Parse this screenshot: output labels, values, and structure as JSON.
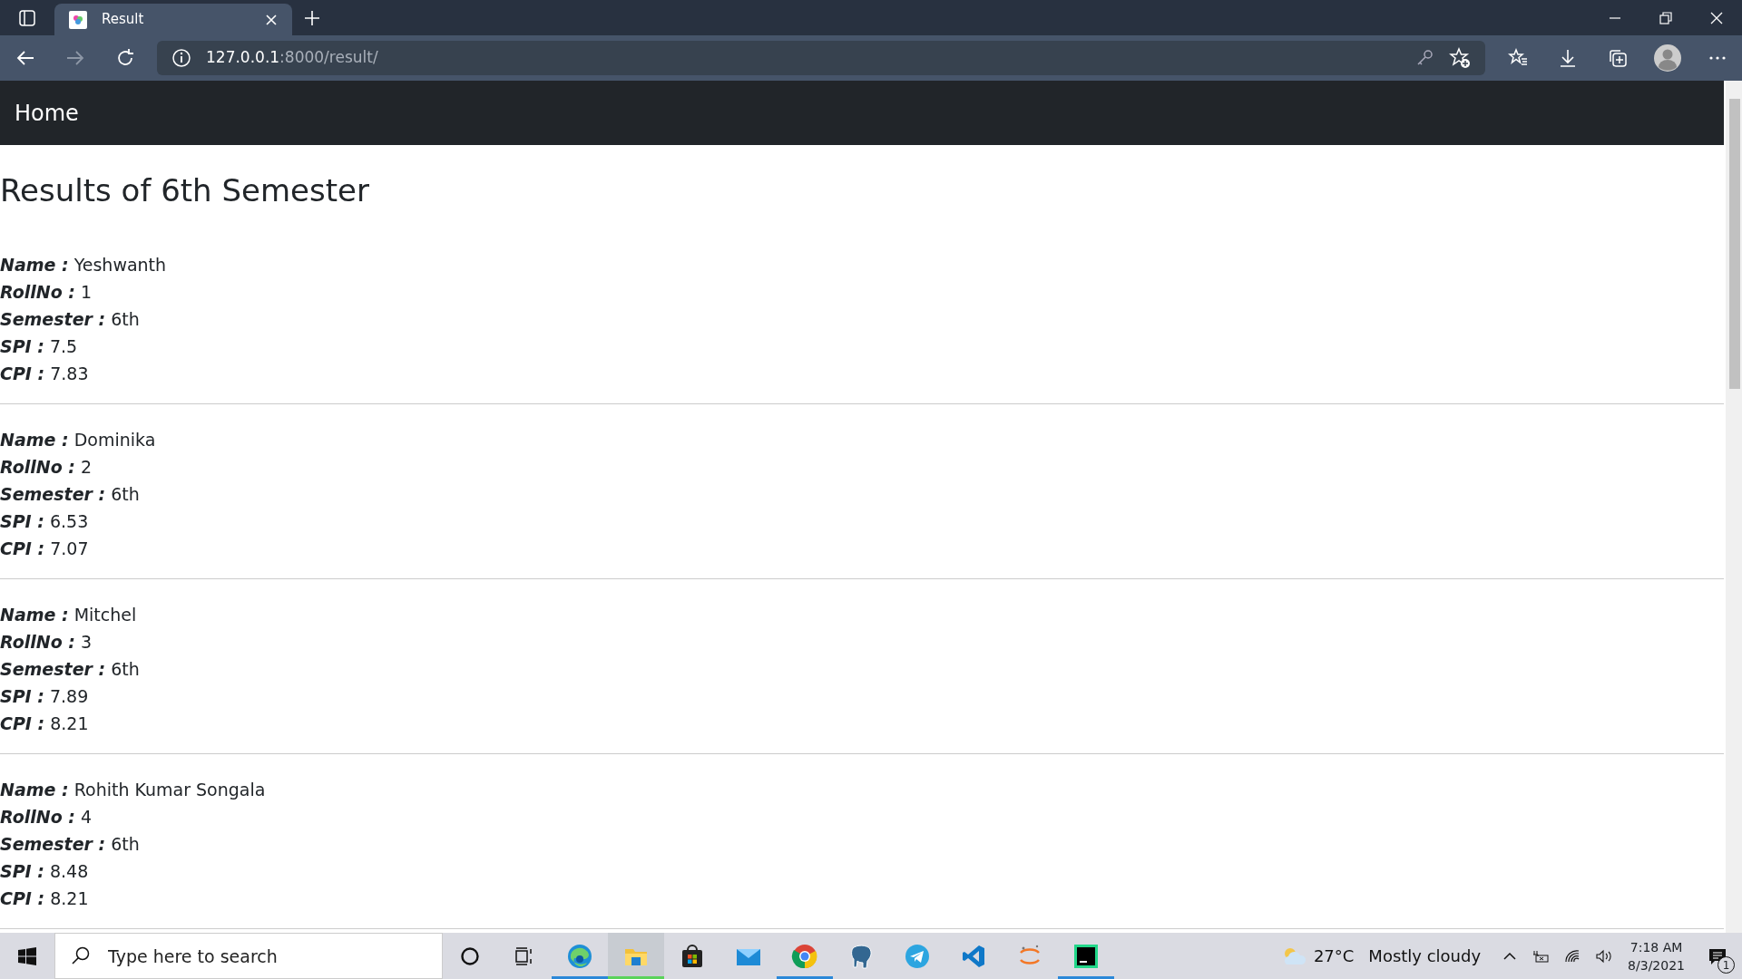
{
  "browser": {
    "tab": {
      "title": "Result",
      "selected": true
    },
    "address": {
      "host": "127.0.0.1",
      "rest": ":8000/result/"
    }
  },
  "navbar": {
    "brand": "Home"
  },
  "heading": "Results of 6th Semester",
  "records": [
    {
      "fields": [
        {
          "label": "Name :",
          "value": "Yeshwanth"
        },
        {
          "label": "RollNo :",
          "value": "1"
        },
        {
          "label": "Semester :",
          "value": "6th"
        },
        {
          "label": "SPI :",
          "value": "7.5"
        },
        {
          "label": "CPI :",
          "value": "7.83"
        }
      ]
    },
    {
      "fields": [
        {
          "label": "Name :",
          "value": "Dominika"
        },
        {
          "label": "RollNo :",
          "value": "2"
        },
        {
          "label": "Semester :",
          "value": "6th"
        },
        {
          "label": "SPI :",
          "value": "6.53"
        },
        {
          "label": "CPI :",
          "value": "7.07"
        }
      ]
    },
    {
      "fields": [
        {
          "label": "Name :",
          "value": "Mitchel"
        },
        {
          "label": "RollNo :",
          "value": "3"
        },
        {
          "label": "Semester :",
          "value": "6th"
        },
        {
          "label": "SPI :",
          "value": "7.89"
        },
        {
          "label": "CPI :",
          "value": "8.21"
        }
      ]
    },
    {
      "fields": [
        {
          "label": "Name :",
          "value": "Rohith Kumar Songala"
        },
        {
          "label": "RollNo :",
          "value": "4"
        },
        {
          "label": "Semester :",
          "value": "6th"
        },
        {
          "label": "SPI :",
          "value": "8.48"
        },
        {
          "label": "CPI :",
          "value": "8.21"
        }
      ]
    }
  ],
  "taskbar": {
    "search": {
      "placeholder": "Type here to search"
    },
    "apps": [
      {
        "kind": "edge",
        "running": true,
        "selected": false
      },
      {
        "kind": "folder",
        "running": true,
        "selected": true
      },
      {
        "kind": "store",
        "running": false,
        "selected": false
      },
      {
        "kind": "mail",
        "running": false,
        "selected": false
      },
      {
        "kind": "chrome",
        "running": true,
        "selected": false
      },
      {
        "kind": "elephant",
        "running": false,
        "selected": false
      },
      {
        "kind": "telegram",
        "running": false,
        "selected": false
      },
      {
        "kind": "vscode",
        "running": false,
        "selected": false
      },
      {
        "kind": "jupyter",
        "running": false,
        "selected": false
      },
      {
        "kind": "pycharm",
        "running": true,
        "selected": false
      }
    ],
    "weather": {
      "temperature": "27°C",
      "condition": "Mostly cloudy"
    },
    "time": "7:18 AM",
    "date": "8/3/2021",
    "notifications": "1"
  }
}
